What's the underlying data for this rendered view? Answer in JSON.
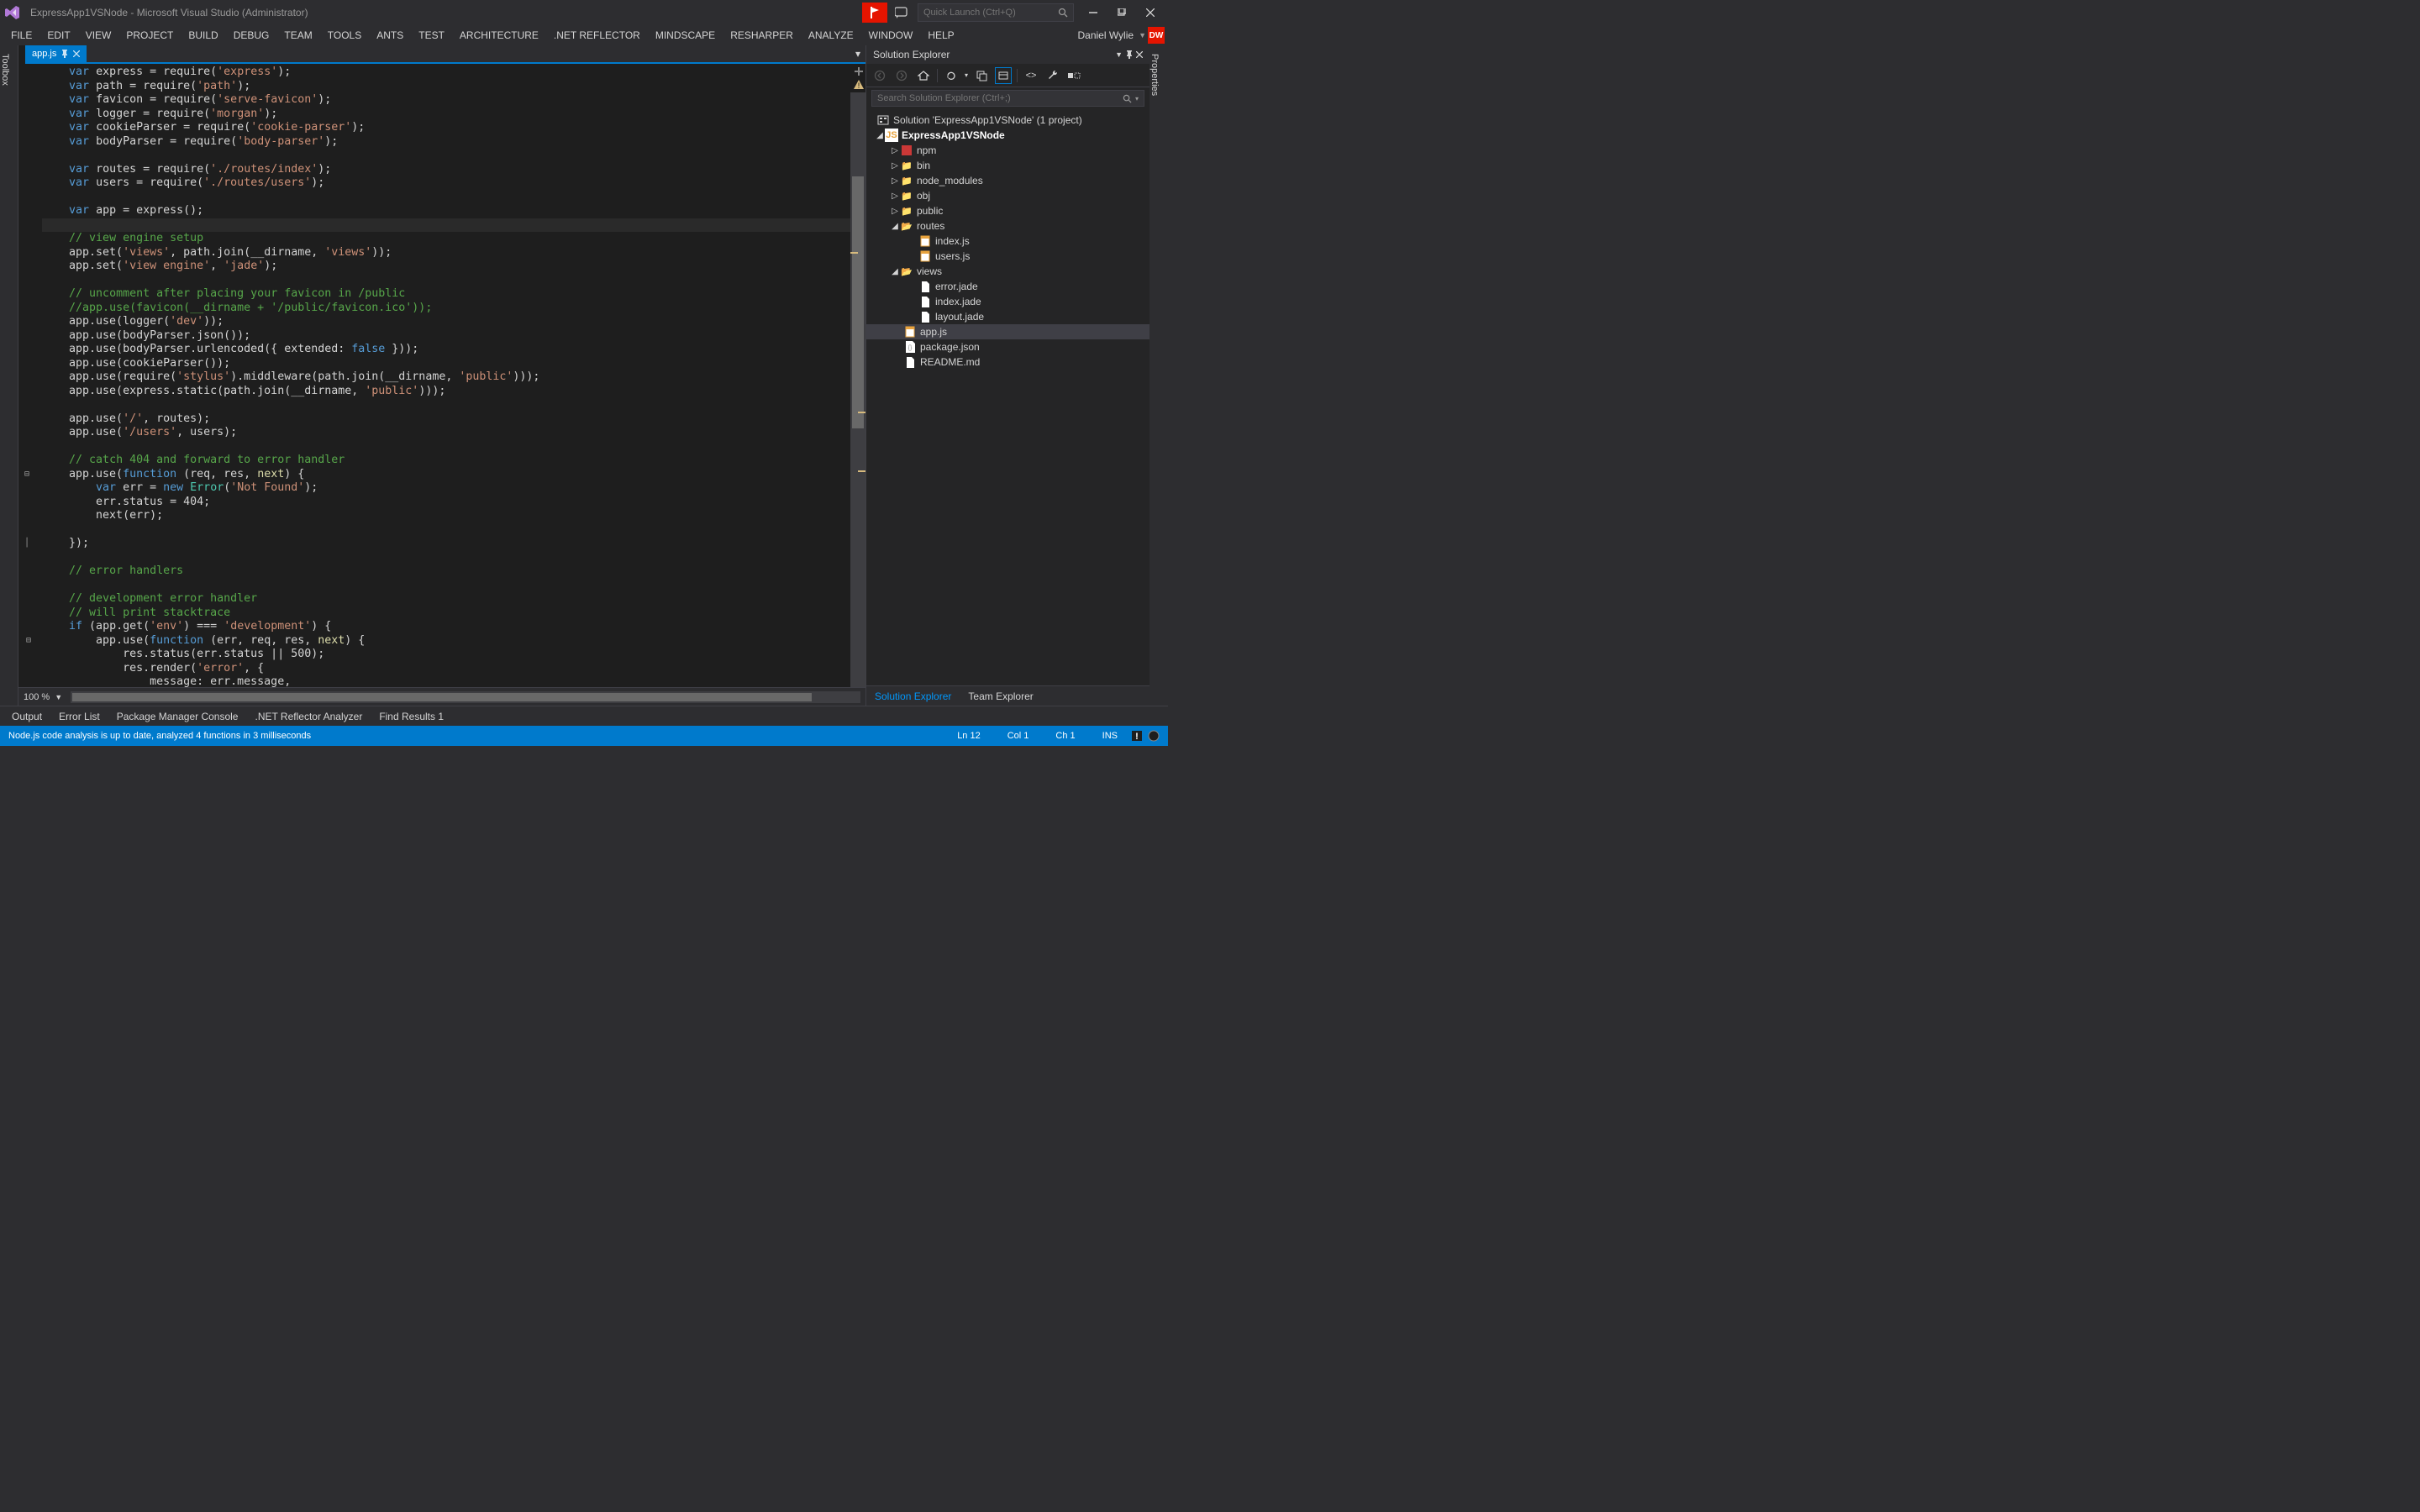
{
  "titlebar": {
    "title": "ExpressApp1VSNode - Microsoft Visual Studio (Administrator)",
    "quick_launch_placeholder": "Quick Launch (Ctrl+Q)"
  },
  "menu": {
    "items": [
      "FILE",
      "EDIT",
      "VIEW",
      "PROJECT",
      "BUILD",
      "DEBUG",
      "TEAM",
      "TOOLS",
      "ANTS",
      "TEST",
      "ARCHITECTURE",
      ".NET REFLECTOR",
      "MINDSCAPE",
      "RESHARPER",
      "ANALYZE",
      "WINDOW",
      "HELP"
    ],
    "user": "Daniel Wylie",
    "badge": "DW"
  },
  "left_tool": {
    "label": "Toolbox"
  },
  "right_tool": {
    "label": "Properties"
  },
  "tabs": {
    "active": "app.js"
  },
  "editor": {
    "zoom": "100 %"
  },
  "solution": {
    "title": "Solution Explorer",
    "search_placeholder": "Search Solution Explorer (Ctrl+;)",
    "root": "Solution 'ExpressApp1VSNode' (1 project)",
    "project": "ExpressApp1VSNode",
    "items": {
      "npm": "npm",
      "bin": "bin",
      "node_modules": "node_modules",
      "obj": "obj",
      "public": "public",
      "routes": "routes",
      "routes_index": "index.js",
      "routes_users": "users.js",
      "views": "views",
      "views_error": "error.jade",
      "views_index": "index.jade",
      "views_layout": "layout.jade",
      "appjs": "app.js",
      "package": "package.json",
      "readme": "README.md"
    },
    "bottom_tabs": {
      "sol": "Solution Explorer",
      "team": "Team Explorer"
    }
  },
  "bottom_tabs": {
    "output": "Output",
    "errors": "Error List",
    "pmc": "Package Manager Console",
    "reflector": ".NET Reflector Analyzer",
    "find": "Find Results 1"
  },
  "status": {
    "msg": "Node.js code analysis is up to date, analyzed 4 functions in 3 milliseconds",
    "ln": "Ln 12",
    "col": "Col 1",
    "ch": "Ch 1",
    "ins": "INS"
  },
  "code": {
    "l1": "var express = require('express');",
    "l2": "var path = require('path');",
    "l3": "var favicon = require('serve-favicon');",
    "l4": "var logger = require('morgan');",
    "l5": "var cookieParser = require('cookie-parser');",
    "l6": "var bodyParser = require('body-parser');",
    "l7": "",
    "l8": "var routes = require('./routes/index');",
    "l9": "var users = require('./routes/users');",
    "l10": "",
    "l11": "var app = express();",
    "l12": "",
    "l13": "// view engine setup",
    "l14": "app.set('views', path.join(__dirname, 'views'));",
    "l15": "app.set('view engine', 'jade');",
    "l16": "",
    "l17": "// uncomment after placing your favicon in /public",
    "l18": "//app.use(favicon(__dirname + '/public/favicon.ico'));",
    "l19": "app.use(logger('dev'));",
    "l20": "app.use(bodyParser.json());",
    "l21": "app.use(bodyParser.urlencoded({ extended: false }));",
    "l22": "app.use(cookieParser());",
    "l23": "app.use(require('stylus').middleware(path.join(__dirname, 'public')));",
    "l24": "app.use(express.static(path.join(__dirname, 'public')));",
    "l25": "",
    "l26": "app.use('/', routes);",
    "l27": "app.use('/users', users);",
    "l28": "",
    "l29": "// catch 404 and forward to error handler",
    "l30": "app.use(function (req, res, next) {",
    "l31": "    var err = new Error('Not Found');",
    "l32": "    err.status = 404;",
    "l33": "    next(err);",
    "l34": "",
    "l35": "});",
    "l36": "",
    "l37": "// error handlers",
    "l38": "",
    "l39": "// development error handler",
    "l40": "// will print stacktrace",
    "l41": "if (app.get('env') === 'development') {",
    "l42": "    app.use(function (err, req, res, next) {",
    "l43": "        res.status(err.status || 500);",
    "l44": "        res.render('error', {",
    "l45": "            message: err.message,"
  }
}
